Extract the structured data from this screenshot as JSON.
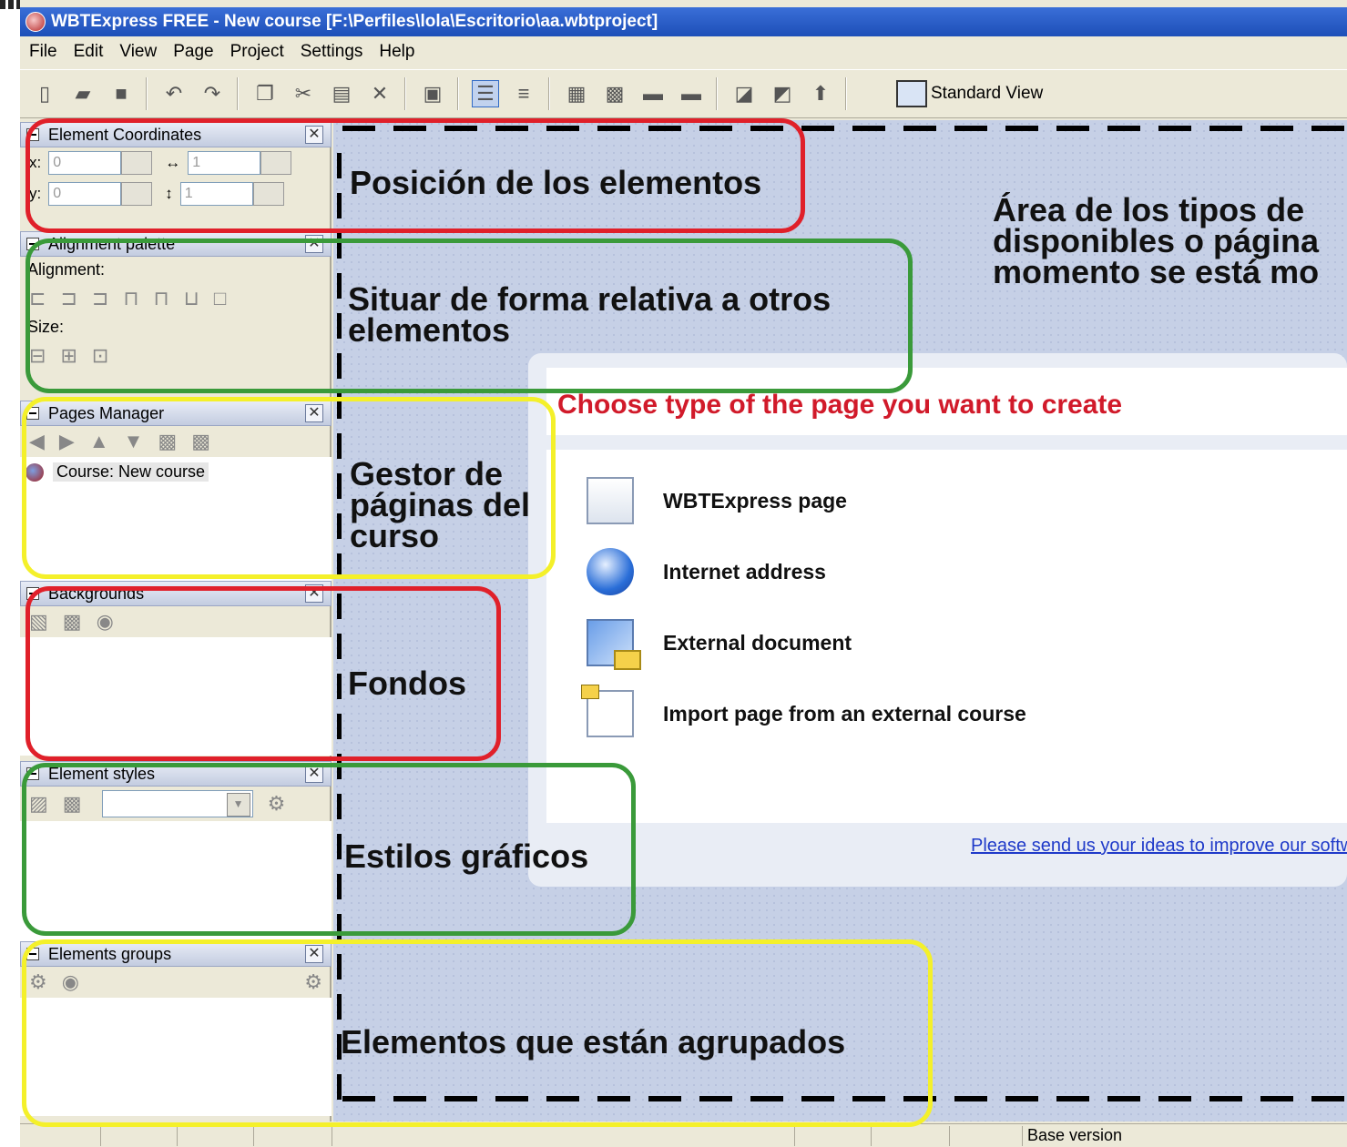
{
  "window": {
    "title": "WBTExpress FREE - New course [F:\\Perfiles\\lola\\Escritorio\\aa.wbtproject]"
  },
  "menu": [
    "File",
    "Edit",
    "View",
    "Page",
    "Project",
    "Settings",
    "Help"
  ],
  "toolbar": {
    "standard_view": "Standard View"
  },
  "panels": {
    "coords": {
      "title": "Element Coordinates",
      "x_label": "x:",
      "y_label": "y:",
      "x": "0",
      "y": "0",
      "w": "1",
      "h": "1"
    },
    "align": {
      "title": "Alignment palette",
      "alignment": "Alignment:",
      "size": "Size:"
    },
    "pages": {
      "title": "Pages Manager",
      "course": "Course: New course"
    },
    "backgrounds": {
      "title": "Backgrounds"
    },
    "styles": {
      "title": "Element styles"
    },
    "groups": {
      "title": "Elements groups"
    }
  },
  "dialog": {
    "title": "Choose type of the page you want to create",
    "options": [
      "WBTExpress page",
      "Internet address",
      "External document",
      "Import page from an external course"
    ],
    "link": "Please send us your ideas to improve our software"
  },
  "annotations": {
    "posicion": "Posición de los elementos",
    "situar_1": "Situar de forma relativa a otros",
    "situar_2": "elementos",
    "gestor_1": "Gestor de",
    "gestor_2": "páginas del",
    "gestor_3": "curso",
    "fondos": "Fondos",
    "estilos": "Estilos gráficos",
    "agrupados": "Elementos que están agrupados",
    "area_1": "Área de los tipos de",
    "area_2": "disponibles o página",
    "area_3": "momento se está mo"
  },
  "status": {
    "version": "Base version"
  }
}
